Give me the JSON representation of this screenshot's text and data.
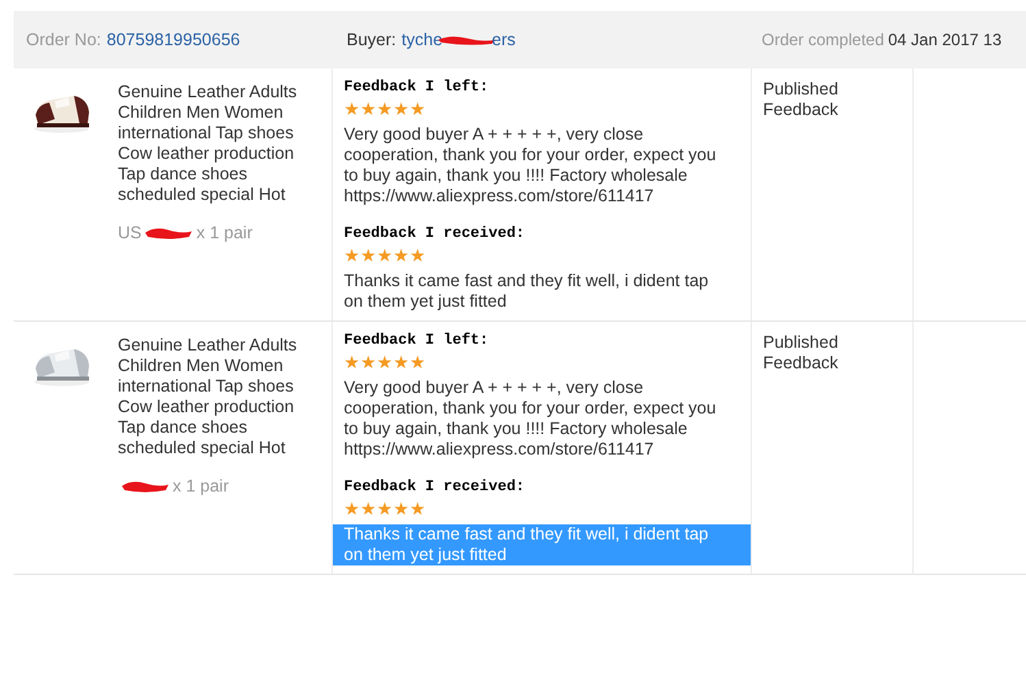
{
  "order": {
    "number_label": "Order No:",
    "number": "80759819950656",
    "buyer_label": "Buyer:",
    "buyer_start": "tyche",
    "buyer_end": "ers",
    "status_label": "Order completed",
    "date": "04 Jan 2017 13"
  },
  "items": [
    {
      "title": "Genuine Leather Adults Children Men Women international Tap shoes Cow leather production Tap dance shoes scheduled special Hot",
      "price_prefix": "US",
      "quantity": "x 1 pair",
      "left": {
        "label": "Feedback I left:",
        "stars": 5,
        "text": "Very good buyer A + + + + +, very close cooperation, thank you for your order, expect you to buy again, thank you !!!! Factory wholesale https://www.aliexpress.com/store/611417"
      },
      "received": {
        "label": "Feedback I received:",
        "stars": 5,
        "text": "Thanks it came fast and they fit well, i dident tap on them yet just fitted",
        "selected": false
      },
      "status": "Published Feedback"
    },
    {
      "title": "Genuine Leather Adults Children Men Women international Tap shoes Cow leather production Tap dance shoes scheduled special Hot",
      "quantity": "x 1 pair",
      "left": {
        "label": "Feedback I left:",
        "stars": 5,
        "text": "Very good buyer A + + + + +, very close cooperation, thank you for your order, expect you to buy again, thank you !!!! Factory wholesale https://www.aliexpress.com/store/611417"
      },
      "received": {
        "label": "Feedback I received:",
        "stars": 5,
        "text": "Thanks it came fast and they fit well, i dident tap on them yet just fitted",
        "selected": true
      },
      "status": "Published Feedback"
    }
  ]
}
